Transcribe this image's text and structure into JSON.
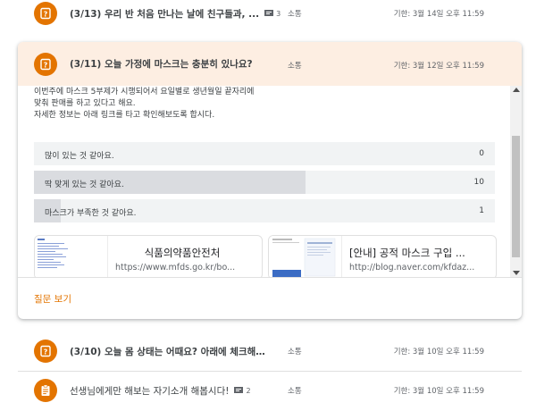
{
  "rows": [
    {
      "title": "(3/13) 우리 반 처음 만나는 날에 친구들과, ...",
      "comments": "3",
      "tag": "소통",
      "due": "기한: 3월 14일 오후 11:59"
    },
    {
      "title": "(3/10) 오늘 몸 상태는 어때요? 아래에 체크해주...",
      "tag": "소통",
      "due": "기한: 3월 10일 오후 11:59"
    },
    {
      "title": "선생님에게만 해보는 자기소개 해봅시다!",
      "comments": "2",
      "tag": "소통",
      "due": "기한: 3월 10일 오후 11:59"
    }
  ],
  "card": {
    "title": "(3/11) 오늘 가정에 마스크는 충분히 있나요?",
    "tag": "소통",
    "due": "기한: 3월 12일 오후 11:59",
    "description": [
      "이번주에 마스크 5부제가 시행되어서 요일별로 생년월일 끝자리에",
      "맞춰 판매를 하고 있다고 해요.",
      "자세한 정보는 아래 링크를 타고 확인해보도록 합시다."
    ],
    "poll": [
      {
        "option": "많이 있는 것 같아요.",
        "count": "0",
        "fraction": 0.0
      },
      {
        "option": "딱 맞게 있는 것 같아요.",
        "count": "10",
        "fraction": 0.59
      },
      {
        "option": "마스크가 부족한 것 같아요.",
        "count": "1",
        "fraction": 0.059
      }
    ],
    "links": [
      {
        "title": "식품의약품안전처",
        "url": "https://www.mfds.go.kr/bo..."
      },
      {
        "title": "[안내] 공적 마스크 구입 ...",
        "url": "http://blog.naver.com/kfdaz..."
      }
    ],
    "view_question": "질문 보기"
  },
  "colors": {
    "accent": "#e37400",
    "highlight_bg": "#fdeee2",
    "poll_fill": "#dadce0",
    "poll_bg": "#f1f3f4"
  },
  "icons": {
    "question": "question-mark-icon",
    "assignment": "assignment-icon",
    "comment": "comment-icon"
  }
}
